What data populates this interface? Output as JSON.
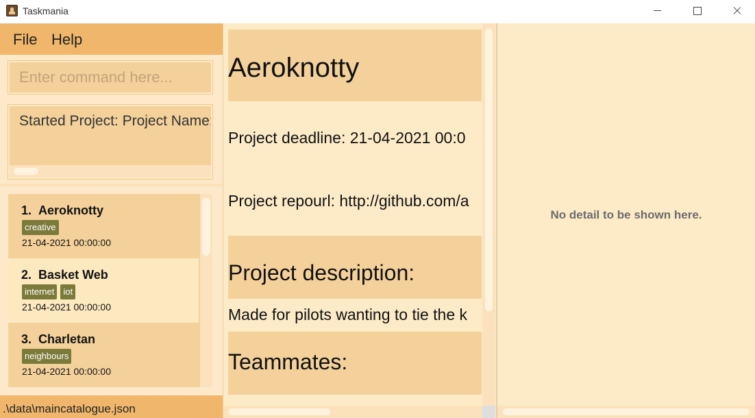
{
  "window": {
    "title": "Taskmania",
    "controls": [
      "minimize",
      "maximize",
      "close"
    ]
  },
  "menu": {
    "items": [
      {
        "label": "File"
      },
      {
        "label": "Help"
      }
    ]
  },
  "command": {
    "placeholder": "Enter command here...",
    "value": ""
  },
  "result": {
    "text": "Started Project:  Project Name:"
  },
  "projects": [
    {
      "index": "1.",
      "name": "Aeroknotty",
      "tags": [
        "creative"
      ],
      "deadline": "21-04-2021 00:00:00"
    },
    {
      "index": "2.",
      "name": "Basket Web",
      "tags": [
        "internet",
        "iot"
      ],
      "deadline": "21-04-2021 00:00:00"
    },
    {
      "index": "3.",
      "name": "Charletan",
      "tags": [
        "neighbours"
      ],
      "deadline": "21-04-2021 00:00:00"
    }
  ],
  "status": {
    "path": ".\\data\\maincatalogue.json"
  },
  "detail": {
    "title": "Aeroknotty",
    "deadline_line": "Project deadline: 21-04-2021 00:0",
    "repo_line": "Project repourl: http://github.com/a",
    "description_heading": "Project description:",
    "description_text": "Made for pilots wanting to tie the k",
    "teammates_heading": "Teammates:"
  },
  "side_detail": {
    "empty_message": "No detail to be shown here."
  },
  "colors": {
    "menubar": "#f0b66b",
    "panel": "#fde9c9",
    "card": "#f4d19b",
    "tag": "#7b7a3a"
  }
}
